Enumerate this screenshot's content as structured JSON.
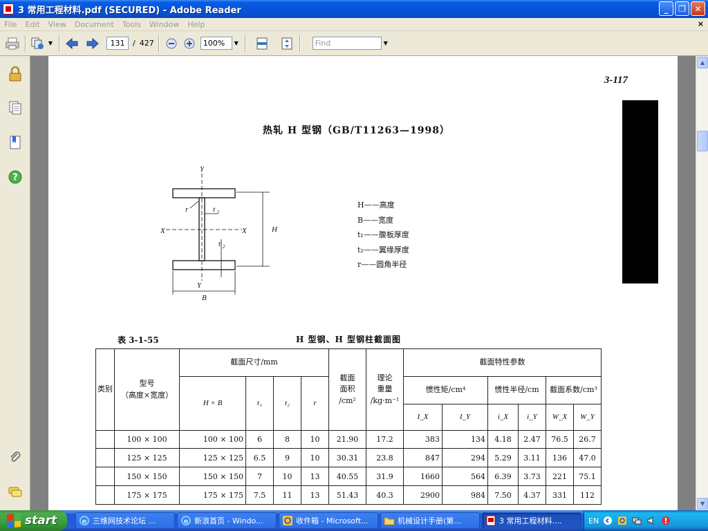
{
  "window": {
    "title": "3 常用工程材料.pdf (SECURED) - Adobe Reader",
    "min": "_",
    "max": "❐",
    "close": "✕"
  },
  "menu": {
    "items": [
      "File",
      "Edit",
      "View",
      "Document",
      "Tools",
      "Window",
      "Help"
    ],
    "close_doc": "×"
  },
  "toolbar": {
    "page_current": "131",
    "page_separator": "/",
    "page_total": "427",
    "zoom": "100%",
    "find_placeholder": "Find"
  },
  "page": {
    "page_number": "3-117",
    "title": "热轧 H 型钢（GB/T11263—1998）",
    "figure_labels": {
      "y_top": "Y",
      "y_bottom": "Y",
      "x_left": "X",
      "x_right": "X",
      "r": "r",
      "t1": "t",
      "t1_sub": "1",
      "t2": "t",
      "t2_sub": "2",
      "h": "H",
      "b": "B"
    },
    "legend": [
      "H——高度",
      "B——宽度",
      "t₁——腹板厚度",
      "t₂——翼缘厚度",
      "r——圆角半径"
    ],
    "table_label": "表 3-1-55",
    "table_title": "H 型钢、H 型钢柱截面图",
    "table": {
      "h_category": "类别",
      "h_model": "型号",
      "h_model_sub": "（高度×宽度）",
      "h_section_dims": "截面尺寸/mm",
      "h_section_area": "截面",
      "h_section_area2": "面积",
      "h_section_area3": "/cm²",
      "h_theory": "理论",
      "h_theory2": "重量",
      "h_theory3": "/kg·m⁻¹",
      "h_props": "截面特性参数",
      "h_inertia": "惯性矩/cm⁴",
      "h_radius": "惯性半径/cm",
      "h_modulus": "截面系数/cm³",
      "h_hxb": "H × B",
      "h_t1": "t₁",
      "h_t2": "t₂",
      "h_r": "r",
      "h_ix": "I_X",
      "h_iy": "I_Y",
      "h_rix": "i_X",
      "h_riy": "i_Y",
      "h_wx": "W_X",
      "h_wy": "W_Y",
      "rows": [
        [
          "",
          "100 × 100",
          "100 × 100",
          "6",
          "8",
          "10",
          "21.90",
          "17.2",
          "383",
          "134",
          "4.18",
          "2.47",
          "76.5",
          "26.7"
        ],
        [
          "",
          "125 × 125",
          "125 × 125",
          "6.5",
          "9",
          "10",
          "30.31",
          "23.8",
          "847",
          "294",
          "5.29",
          "3.11",
          "136",
          "47.0"
        ],
        [
          "",
          "150 × 150",
          "150 × 150",
          "7",
          "10",
          "13",
          "40.55",
          "31.9",
          "1660",
          "564",
          "6.39",
          "3.73",
          "221",
          "75.1"
        ],
        [
          "",
          "175 × 175",
          "175 × 175",
          "7.5",
          "11",
          "13",
          "51.43",
          "40.3",
          "2900",
          "984",
          "7.50",
          "4.37",
          "331",
          "112"
        ]
      ]
    }
  },
  "taskbar": {
    "start": "start",
    "tasks": [
      "三维网技术论坛 ...",
      "新浪首页 - Windo...",
      "收件箱 - Microsoft...",
      "机械设计手册(第...",
      "3 常用工程材料...."
    ],
    "tray_lang": "EN"
  },
  "colors": {
    "titlebar": "#0654d8",
    "taskbar": "#245edb",
    "start": "#379f37",
    "chrome": "#ece9d8"
  }
}
